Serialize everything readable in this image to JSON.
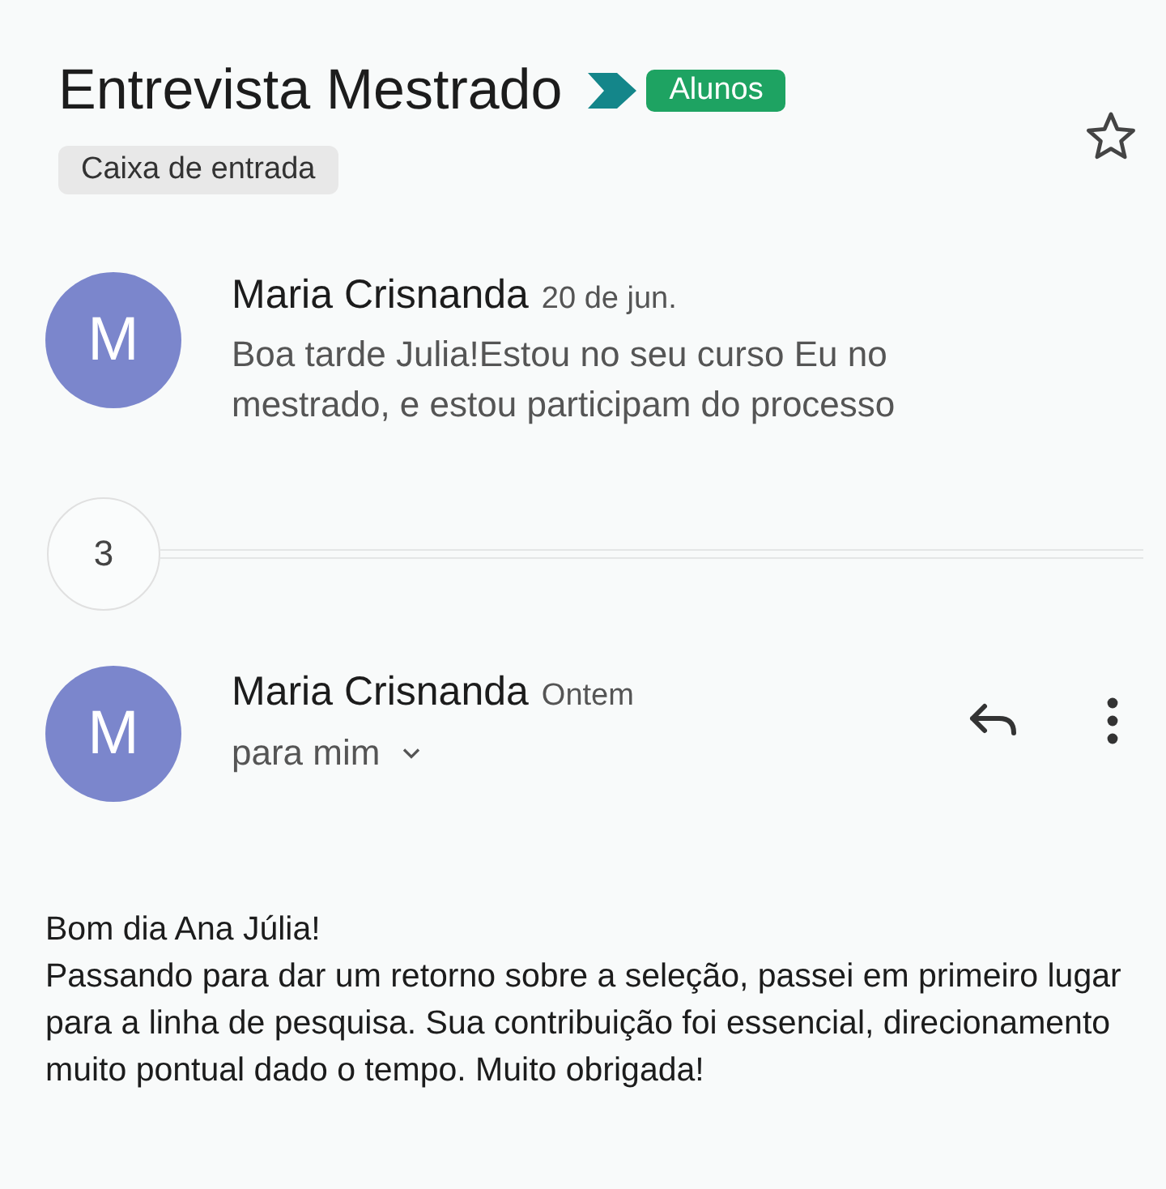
{
  "thread": {
    "subject": "Entrevista Mestrado",
    "labels": [
      {
        "text": "Alunos",
        "color": "#1ea362"
      }
    ],
    "folder": "Caixa de entrada",
    "starred": false
  },
  "messages": [
    {
      "kind": "collapsed",
      "avatar": "M",
      "sender": "Maria Crisnanda",
      "date": "20 de jun.",
      "snippet": "Boa tarde Julia!Estou no seu curso Eu no mestrado, e estou participam do processo"
    },
    {
      "kind": "count",
      "count": "3"
    },
    {
      "kind": "expanded",
      "avatar": "M",
      "sender": "Maria Crisnanda",
      "date": "Ontem",
      "recipient": "para mim",
      "body": [
        "Bom dia Ana Júlia!",
        "Passando para dar um retorno sobre a seleção, passei em primeiro lugar para a linha de pesquisa. Sua contribuição foi essencial, direcionamento muito pontual dado o tempo. Muito obrigada!"
      ]
    }
  ]
}
